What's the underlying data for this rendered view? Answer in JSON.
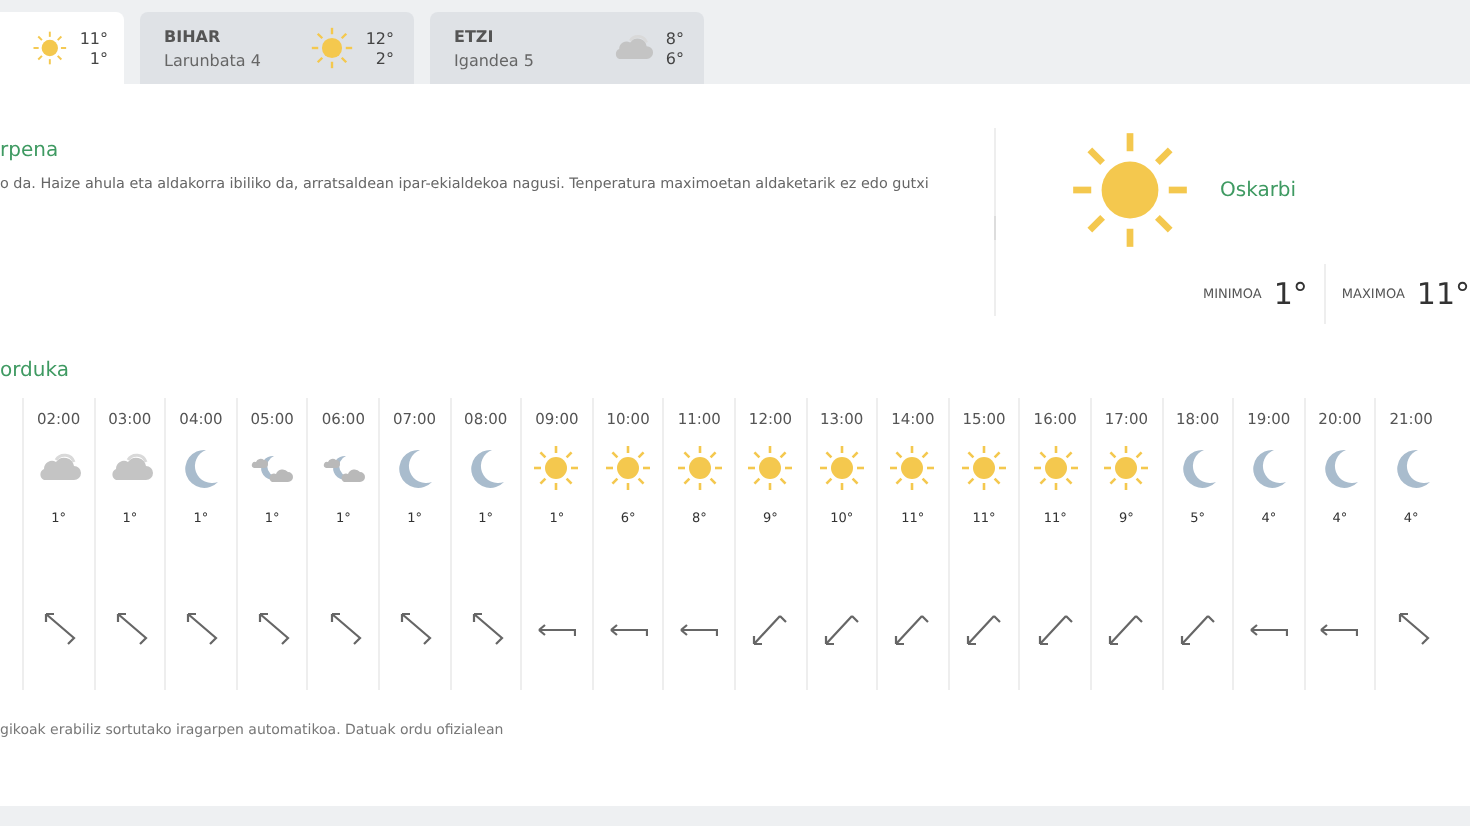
{
  "day_tabs": [
    {
      "kind": "sun",
      "max": "11°",
      "min": "1°",
      "selected": true
    },
    {
      "day": "BIHAR",
      "date": "Larunbata 4",
      "kind": "sun",
      "max": "12°",
      "min": "2°",
      "selected": false
    },
    {
      "day": "ETZI",
      "date": "Igandea 5",
      "kind": "cloud",
      "max": "8°",
      "min": "6°",
      "selected": false
    }
  ],
  "summary": {
    "heading": "rpena",
    "text": "o da. Haize ahula eta aldakorra ibiliko da, arratsaldean ipar-ekialdekoa nagusi. Tenperatura maximoetan aldaketarik ez edo gutxi",
    "kind": "sun",
    "condition": "Oskarbi",
    "min_label": "MINIMOA",
    "min": "1°",
    "max_label": "MAXIMOA",
    "max": "11°"
  },
  "hourly": {
    "heading": "orduka",
    "hours": [
      {
        "time": "02:00",
        "kind": "cloud",
        "temp": "1°",
        "wind": {
          "kind": "nw"
        }
      },
      {
        "time": "03:00",
        "kind": "cloud",
        "temp": "1°",
        "wind": {
          "kind": "nw"
        }
      },
      {
        "time": "04:00",
        "kind": "moon",
        "temp": "1°",
        "wind": {
          "kind": "nw"
        }
      },
      {
        "time": "05:00",
        "kind": "moon-cloud",
        "temp": "1°",
        "wind": {
          "kind": "nw"
        }
      },
      {
        "time": "06:00",
        "kind": "moon-cloud",
        "temp": "1°",
        "wind": {
          "kind": "nw"
        }
      },
      {
        "time": "07:00",
        "kind": "moon",
        "temp": "1°",
        "wind": {
          "kind": "nw"
        }
      },
      {
        "time": "08:00",
        "kind": "moon",
        "temp": "1°",
        "wind": {
          "kind": "nw"
        }
      },
      {
        "time": "09:00",
        "kind": "sun",
        "temp": "1°",
        "wind": {
          "kind": "w"
        }
      },
      {
        "time": "10:00",
        "kind": "sun",
        "temp": "6°",
        "wind": {
          "kind": "w"
        }
      },
      {
        "time": "11:00",
        "kind": "sun",
        "temp": "8°",
        "wind": {
          "kind": "w"
        }
      },
      {
        "time": "12:00",
        "kind": "sun",
        "temp": "9°",
        "wind": {
          "kind": "sw"
        }
      },
      {
        "time": "13:00",
        "kind": "sun",
        "temp": "10°",
        "wind": {
          "kind": "sw"
        }
      },
      {
        "time": "14:00",
        "kind": "sun",
        "temp": "11°",
        "wind": {
          "kind": "sw"
        }
      },
      {
        "time": "15:00",
        "kind": "sun",
        "temp": "11°",
        "wind": {
          "kind": "sw"
        }
      },
      {
        "time": "16:00",
        "kind": "sun",
        "temp": "11°",
        "wind": {
          "kind": "sw"
        }
      },
      {
        "time": "17:00",
        "kind": "sun",
        "temp": "9°",
        "wind": {
          "kind": "sw"
        }
      },
      {
        "time": "18:00",
        "kind": "moon",
        "temp": "5°",
        "wind": {
          "kind": "sw"
        }
      },
      {
        "time": "19:00",
        "kind": "moon",
        "temp": "4°",
        "wind": {
          "kind": "w"
        }
      },
      {
        "time": "20:00",
        "kind": "moon",
        "temp": "4°",
        "wind": {
          "kind": "w"
        }
      },
      {
        "time": "21:00",
        "kind": "moon",
        "temp": "4°",
        "wind": {
          "kind": "nw"
        }
      }
    ]
  },
  "footer": "gikoak erabiliz sortutako iragarpen automatikoa. Datuak ordu ofizialean"
}
